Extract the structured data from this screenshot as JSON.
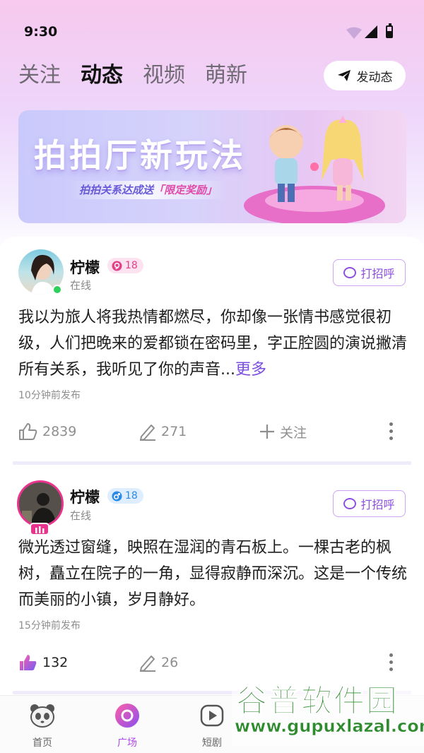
{
  "status_bar": {
    "time": "9:30"
  },
  "tabs": [
    {
      "label": "关注"
    },
    {
      "label": "动态"
    },
    {
      "label": "视频"
    },
    {
      "label": "萌新"
    }
  ],
  "post_button": {
    "label": "发动态"
  },
  "banner": {
    "title": "拍拍厅新玩法",
    "subtitle": "拍拍关系达成送",
    "highlight": "「限定奖励」"
  },
  "posts": [
    {
      "username": "柠檬",
      "gender": "female",
      "age": "18",
      "status": "在线",
      "greet_label": "打招呼",
      "text": "我以为旅人将我热情都燃尽，你却像一张情书感觉很初级，人们把晚来的爱都锁在密码里，字正腔圆的演说撇清所有关系，我听见了你的声音...",
      "more_label": "更多",
      "time": "10分钟前发布",
      "likes": "2839",
      "comments": "271",
      "follow_label": "关注"
    },
    {
      "username": "柠檬",
      "gender": "male",
      "age": "18",
      "status": "在线",
      "greet_label": "打招呼",
      "text": "微光透过窗缝，映照在湿润的青石板上。一棵古老的枫树，矗立在院子的一角，显得寂静而深沉。这是一个传统而美丽的小镇，岁月静好。",
      "time": "15分钟前发布",
      "likes": "132",
      "comments": "26"
    }
  ],
  "tabbar": [
    {
      "label": "首页",
      "icon": "panda-icon"
    },
    {
      "label": "广场",
      "icon": "plaza-icon"
    },
    {
      "label": "短剧",
      "icon": "play-icon"
    }
  ],
  "watermark": {
    "title": "谷普软件园",
    "url": "www.gupuxlazal.com"
  },
  "colors": {
    "accent": "#b348e8",
    "greet": "#8d4fe0",
    "online": "#2ecf5a"
  }
}
